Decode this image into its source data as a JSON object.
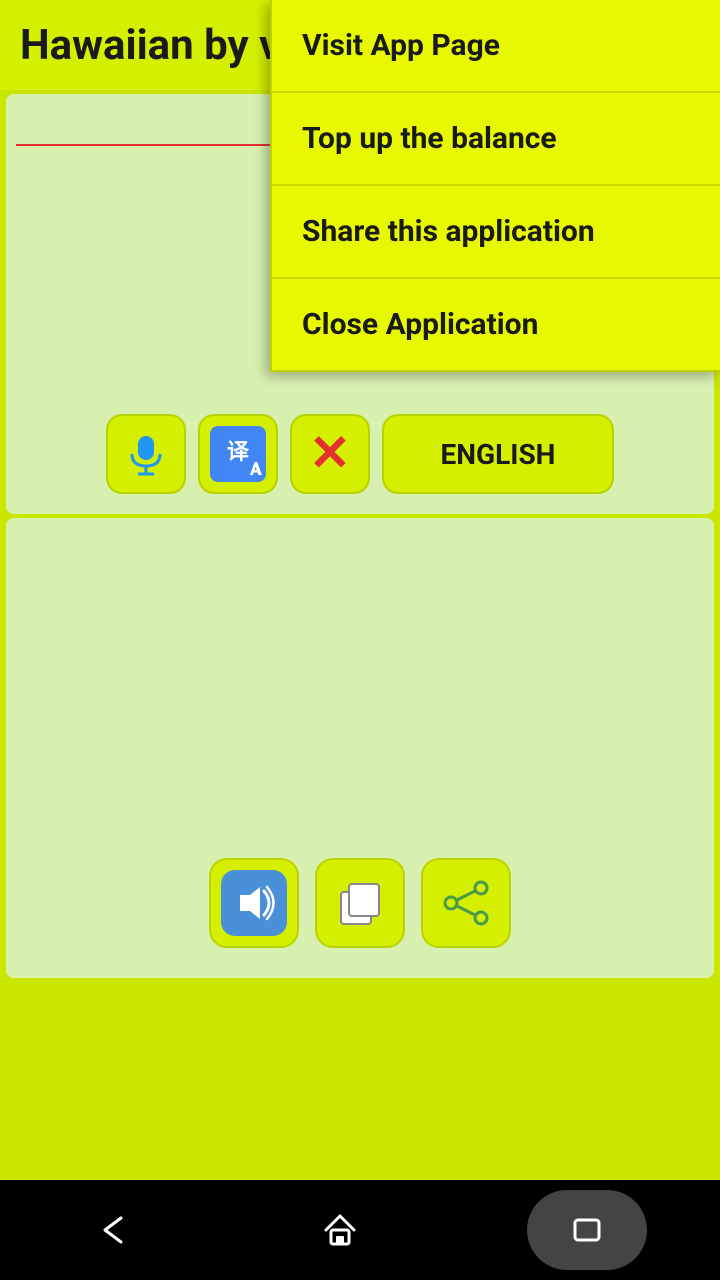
{
  "header": {
    "title": "Hawaiian by voi"
  },
  "menu": {
    "items": [
      {
        "id": "visit-app",
        "label": "Visit App Page"
      },
      {
        "id": "top-up",
        "label": "Top up the balance"
      },
      {
        "id": "share-app",
        "label": "Share this application"
      },
      {
        "id": "close-app",
        "label": "Close Application"
      }
    ]
  },
  "toolbar": {
    "mic_label": "🎤",
    "translate_label": "Translate",
    "close_label": "✖",
    "english_label": "ENGLISH"
  },
  "bottom_toolbar": {
    "speaker_label": "🔊",
    "copy_label": "📋",
    "share_label": "Share"
  },
  "nav": {
    "back_label": "←",
    "home_label": "⌂",
    "recent_label": "❏"
  },
  "colors": {
    "accent": "#d4f000",
    "bg": "#c8e600",
    "panel": "#d8f0b0",
    "menu": "#e8f800",
    "red_x": "#e53030",
    "speaker_bg": "#4a90d9"
  }
}
